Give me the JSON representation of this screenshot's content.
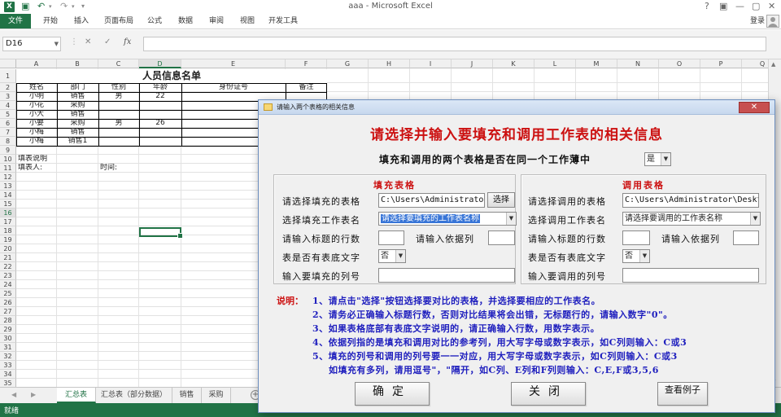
{
  "window": {
    "title": "aaa - Microsoft Excel",
    "controls": [
      "?",
      "▣",
      "—",
      "▢",
      "✕"
    ]
  },
  "ribbon": {
    "file": "文件",
    "tabs": [
      "开始",
      "插入",
      "页面布局",
      "公式",
      "数据",
      "审阅",
      "视图",
      "开发工具"
    ],
    "signin": "登录"
  },
  "formula_bar": {
    "name_box": "D16",
    "cancel": "✕",
    "enter": "✓",
    "fx": "fx",
    "value": ""
  },
  "grid": {
    "columns": [
      "A",
      "B",
      "C",
      "D",
      "E",
      "F",
      "G",
      "H",
      "I",
      "J",
      "K",
      "L",
      "M",
      "N",
      "O",
      "P",
      "Q"
    ],
    "selected_column": "D",
    "selected_row": "16",
    "rows": [
      "1",
      "2",
      "3",
      "4",
      "5",
      "6",
      "7",
      "8",
      "9",
      "10",
      "11",
      "12",
      "13",
      "14",
      "15",
      "16",
      "17",
      "18",
      "19",
      "20",
      "21",
      "22",
      "23",
      "24",
      "25",
      "26",
      "27",
      "28",
      "29",
      "30",
      "31",
      "32",
      "33",
      "34",
      "35"
    ],
    "sheet_title": "人员信息名单",
    "headers": [
      "姓名",
      "部门",
      "性别",
      "年龄",
      "身份证号",
      "备注"
    ],
    "records": [
      [
        "小明",
        "销售",
        "男",
        "22",
        "",
        ""
      ],
      [
        "小花",
        "采购",
        "",
        "",
        "",
        ""
      ],
      [
        "小大",
        "销售",
        "",
        "",
        "",
        ""
      ],
      [
        "小要",
        "采购",
        "男",
        "26",
        "",
        ""
      ],
      [
        "小梅",
        "销售",
        "",
        "",
        "",
        ""
      ],
      [
        "小梅",
        "销售1",
        "",
        "",
        "",
        ""
      ]
    ],
    "footer_note": "填表说明",
    "footer_filler": "填表人:",
    "footer_time": "时间:"
  },
  "sheet_tabs": [
    "汇总表",
    "汇总表（部分数据）",
    "销售",
    "采购"
  ],
  "active_sheet": "汇总表",
  "status": {
    "text": "就绪"
  },
  "dialog": {
    "title": "请输入两个表格的相关信息",
    "close": "✕",
    "main_title": "请选择并输入要填充和调用工作表的相关信息",
    "same_book_label": "填充和调用的两个表格是否在同一个工作薄中",
    "same_book_value": "是",
    "fill": {
      "title": "填充表格",
      "select_table_label": "请选择填充的表格",
      "path": "C:\\Users\\Administrator",
      "browse": "选择",
      "sheet_label": "选择填充工作表名",
      "sheet_value": "请选择要填充的工作表名称",
      "title_rows_label": "请输入标题的行数",
      "title_rows_value": "",
      "key_col_label": "请输入依据列",
      "key_col_value": "",
      "footer_label": "表是否有表底文字",
      "footer_value": "否",
      "cols_label": "输入要填充的列号",
      "cols_value": ""
    },
    "call": {
      "title": "调用表格",
      "select_table_label": "请选择调用的表格",
      "path": "C:\\Users\\Administrator\\Deskto",
      "sheet_label": "选择调用工作表名",
      "sheet_value": "请选择要调用的工作表名称",
      "title_rows_label": "请输入标题的行数",
      "title_rows_value": "",
      "key_col_label": "请输入依据列",
      "key_col_value": "",
      "footer_label": "表是否有表底文字",
      "footer_value": "否",
      "cols_label": "输入要调用的列号",
      "cols_value": ""
    },
    "notes_label": "说明：",
    "notes": [
      "1、请点击\"选择\"按钮选择要对比的表格，并选择要相应的工作表名。",
      "2、请务必正确输入标题行数，否则对比结果将会出错，无标题行的，请输入数字\"0\"。",
      "3、如果表格底部有表底文字说明的，请正确输入行数，用数字表示。",
      "4、依据列指的是填充和调用对比的参考列，用大写字母或数字表示，如C列则输入：C或3",
      "5、填充的列号和调用的列号要一一对应，用大写字母或数字表示，如C列则输入：C或3",
      "如填充有多列，请用逗号\"，\"隔开，如C列、E列和F列则输入：C,E,F或3,5,6"
    ],
    "buttons": {
      "ok": "确定",
      "close": "关闭",
      "example": "查看例子"
    }
  },
  "colors": {
    "excel_green": "#217346",
    "dialog_red": "#cc1111",
    "notes_blue": "#1f1fbe"
  }
}
